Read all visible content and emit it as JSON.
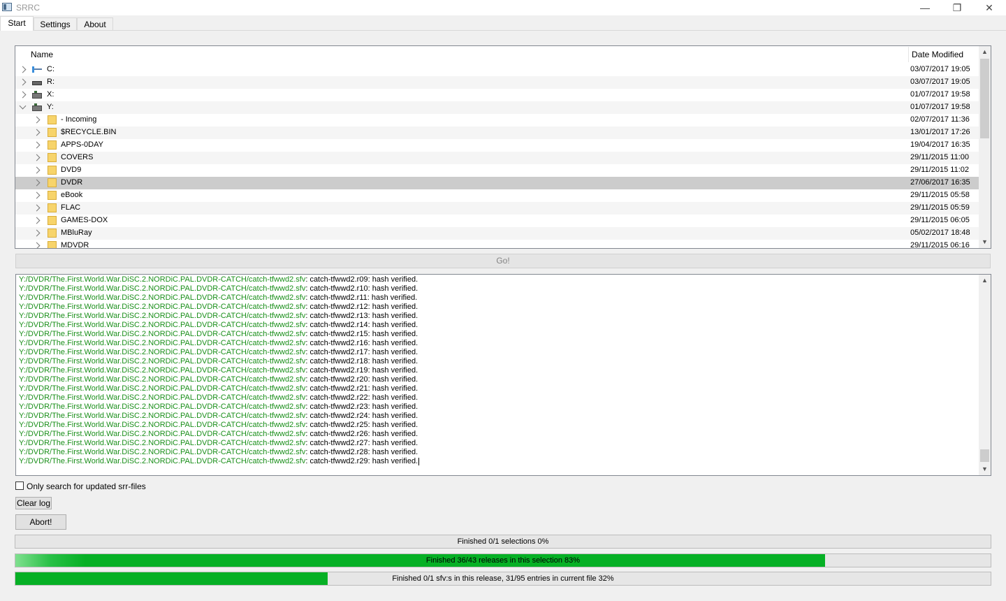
{
  "window": {
    "title": "SRRC",
    "buttons": {
      "minimize": "—",
      "restore": "❐",
      "close": "✕"
    }
  },
  "tabs": [
    {
      "label": "Start",
      "active": true
    },
    {
      "label": "Settings",
      "active": false
    },
    {
      "label": "About",
      "active": false
    }
  ],
  "tree": {
    "columns": {
      "name": "Name",
      "date": "Date Modified"
    },
    "rows": [
      {
        "name": "C:",
        "date": "03/07/2017 19:05",
        "type": "drive",
        "expanded": false
      },
      {
        "name": "R:",
        "date": "03/07/2017 19:05",
        "type": "drive",
        "expanded": false
      },
      {
        "name": "X:",
        "date": "01/07/2017 19:58",
        "type": "network-drive",
        "expanded": false
      },
      {
        "name": "Y:",
        "date": "01/07/2017 19:58",
        "type": "network-drive",
        "expanded": true
      },
      {
        "name": "- Incoming",
        "date": "02/07/2017 11:36",
        "type": "folder"
      },
      {
        "name": "$RECYCLE.BIN",
        "date": "13/01/2017 17:26",
        "type": "folder"
      },
      {
        "name": "APPS-0DAY",
        "date": "19/04/2017 16:35",
        "type": "folder"
      },
      {
        "name": "COVERS",
        "date": "29/11/2015 11:00",
        "type": "folder"
      },
      {
        "name": "DVD9",
        "date": "29/11/2015 11:02",
        "type": "folder"
      },
      {
        "name": "DVDR",
        "date": "27/06/2017 16:35",
        "type": "folder",
        "selected": true
      },
      {
        "name": "eBook",
        "date": "29/11/2015 05:58",
        "type": "folder"
      },
      {
        "name": "FLAC",
        "date": "29/11/2015 05:59",
        "type": "folder"
      },
      {
        "name": "GAMES-DOX",
        "date": "29/11/2015 06:05",
        "type": "folder"
      },
      {
        "name": "MBluRay",
        "date": "05/02/2017 18:48",
        "type": "folder"
      },
      {
        "name": "MDVDR",
        "date": "29/11/2015 06:16",
        "type": "folder"
      }
    ]
  },
  "go_button": "Go!",
  "log": {
    "path": "Y:/DVDR/The.First.World.War.DiSC.2.NORDiC.PAL.DVDR-CATCH/catch-tfwwd2.sfv",
    "lines": [
      ": catch-tfwwd2.r09: hash verified.",
      ": catch-tfwwd2.r10: hash verified.",
      ": catch-tfwwd2.r11: hash verified.",
      ": catch-tfwwd2.r12: hash verified.",
      ": catch-tfwwd2.r13: hash verified.",
      ": catch-tfwwd2.r14: hash verified.",
      ": catch-tfwwd2.r15: hash verified.",
      ": catch-tfwwd2.r16: hash verified.",
      ": catch-tfwwd2.r17: hash verified.",
      ": catch-tfwwd2.r18: hash verified.",
      ": catch-tfwwd2.r19: hash verified.",
      ": catch-tfwwd2.r20: hash verified.",
      ": catch-tfwwd2.r21: hash verified.",
      ": catch-tfwwd2.r22: hash verified.",
      ": catch-tfwwd2.r23: hash verified.",
      ": catch-tfwwd2.r24: hash verified.",
      ": catch-tfwwd2.r25: hash verified.",
      ": catch-tfwwd2.r26: hash verified.",
      ": catch-tfwwd2.r27: hash verified.",
      ": catch-tfwwd2.r28: hash verified.",
      ": catch-tfwwd2.r29: hash verified."
    ],
    "path_color": "#1a8f1a"
  },
  "options": {
    "only_updated_label": "Only search for updated srr-files",
    "only_updated_checked": false
  },
  "buttons": {
    "clear_log": "Clear log",
    "abort": "Abort!"
  },
  "progress": [
    {
      "label": "Finished 0/1 selections 0%",
      "percent": 0
    },
    {
      "label": "Finished 36/43 releases in this selection 83%",
      "percent": 83
    },
    {
      "label": "Finished 0/1 sfv:s in this release, 31/95 entries in current file 32%",
      "percent": 32
    }
  ],
  "colors": {
    "progress_fill": "#06b025",
    "selection": "#cccccc"
  }
}
